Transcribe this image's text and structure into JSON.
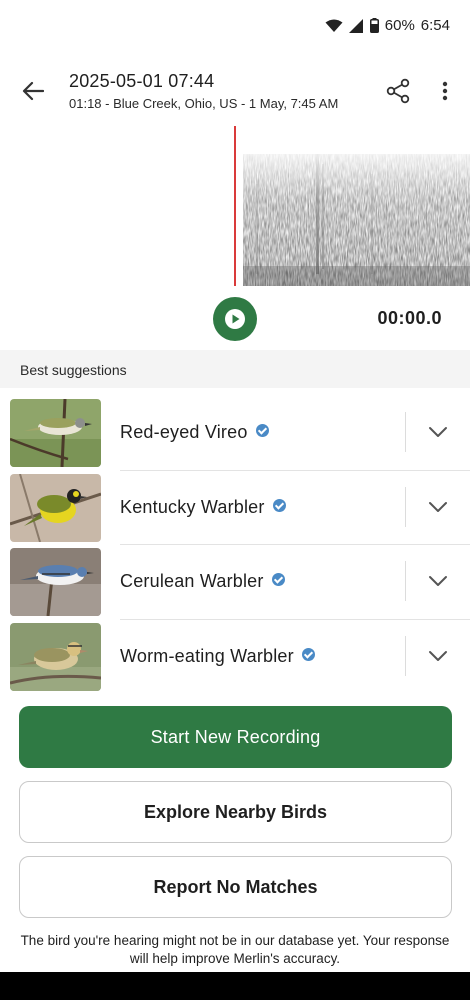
{
  "status_bar": {
    "battery": "60%",
    "time": "6:54"
  },
  "header": {
    "title": "2025-05-01 07:44",
    "subtitle": "01:18 - Blue Creek, Ohio, US - 1 May, 7:45 AM"
  },
  "player": {
    "time": "00:00.0"
  },
  "suggestions": {
    "heading": "Best suggestions",
    "items": [
      {
        "name": "Red-eyed Vireo"
      },
      {
        "name": "Kentucky Warbler"
      },
      {
        "name": "Cerulean Warbler"
      },
      {
        "name": "Worm-eating Warbler"
      }
    ]
  },
  "actions": {
    "start": "Start New Recording",
    "explore": "Explore Nearby Birds",
    "report": "Report No Matches"
  },
  "footnote": "The bird you're hearing might not be in our database yet. Your response will help improve Merlin's accuracy.",
  "colors": {
    "primary": "#2f7a44",
    "playhead": "#d93a3a",
    "verified": "#4a8ac6"
  }
}
